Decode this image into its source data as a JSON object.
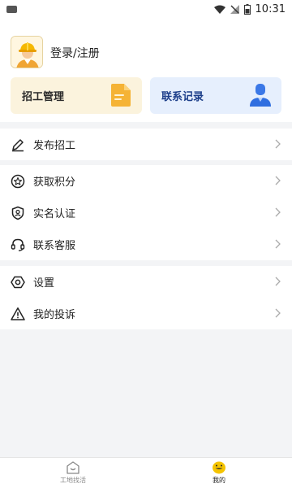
{
  "status_bar": {
    "time": "10:31"
  },
  "profile": {
    "login_text": "登录/注册"
  },
  "cards": {
    "recruit": {
      "label": "招工管理"
    },
    "contact": {
      "label": "联系记录"
    }
  },
  "menu": {
    "publish": {
      "label": "发布招工"
    },
    "points": {
      "label": "获取积分"
    },
    "verify": {
      "label": "实名认证"
    },
    "service": {
      "label": "联系客服"
    },
    "settings": {
      "label": "设置"
    },
    "complaint": {
      "label": "我的投诉"
    }
  },
  "tabs": [
    {
      "label": "工地找活"
    },
    {
      "label": "我的"
    }
  ],
  "colors": {
    "accent_yellow": "#f5b335",
    "accent_blue": "#2f6ee0",
    "recruit_bg": "#fbf3dd",
    "contact_bg": "#e6effd"
  }
}
